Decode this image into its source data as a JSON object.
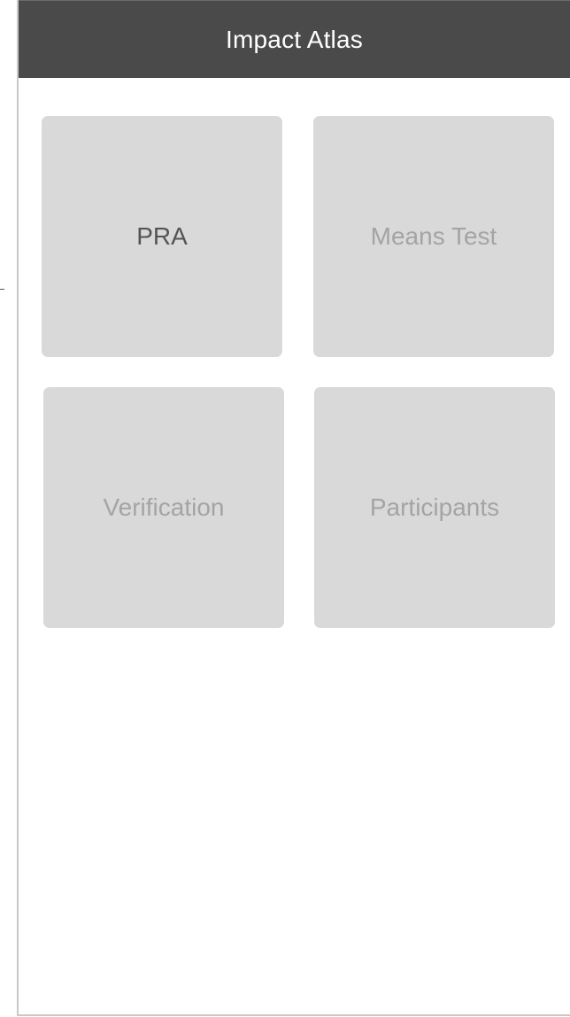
{
  "app": {
    "title": "Impact Atlas"
  },
  "tiles": [
    {
      "label": "PRA",
      "state": "active"
    },
    {
      "label": "Means Test",
      "state": "inactive"
    },
    {
      "label": "Verification",
      "state": "inactive"
    },
    {
      "label": "Participants",
      "state": "inactive"
    }
  ],
  "colors": {
    "header_bg": "#4a4a4a",
    "tile_bg": "#d9d9d9",
    "active_text": "#545454",
    "inactive_text": "#a4a4a4"
  }
}
